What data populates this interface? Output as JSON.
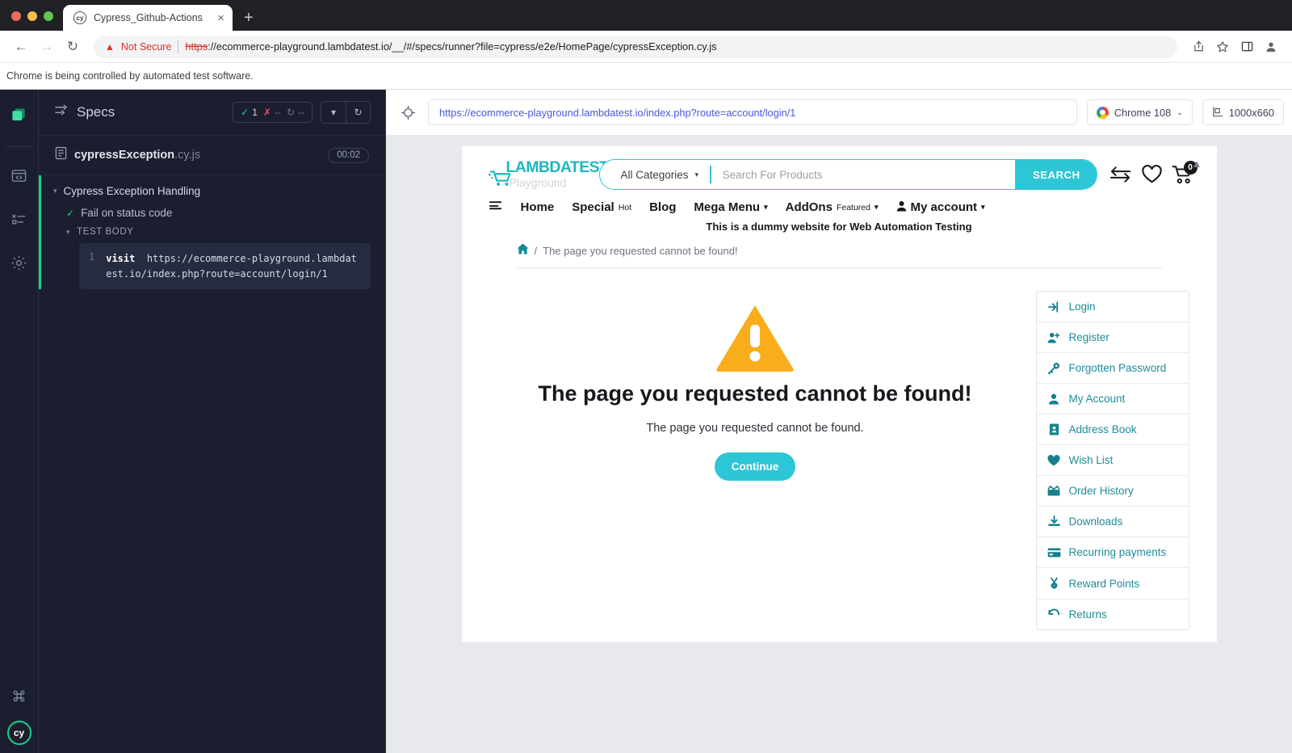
{
  "browser": {
    "tab": {
      "title": "Cypress_Github-Actions",
      "favicon": "cypress-favicon",
      "close": "×"
    },
    "new_tab_label": "+",
    "nav": {
      "back": "←",
      "forward": "→",
      "reload": "↻"
    },
    "omnibox": {
      "security_label": "Not Secure",
      "warning_icon": "warning-triangle-icon",
      "url_scheme": "https",
      "url_rest": "://ecommerce-playground.lambdatest.io/__/#/specs/runner?file=cypress/e2e/HomePage/cypressException.cy.js"
    },
    "toolbar_icons": [
      "share-icon",
      "bookmark-star-icon",
      "side-panel-icon",
      "profile-icon"
    ],
    "automation_notice": "Chrome is being controlled by automated test software."
  },
  "cypress": {
    "rail": [
      {
        "name": "specs-rail-icon"
      },
      {
        "name": "runs-rail-icon"
      },
      {
        "name": "debug-rail-icon"
      },
      {
        "name": "settings-gear-icon"
      }
    ],
    "rail_bottom": {
      "keyboard_shortcut_icon": "command-key-icon",
      "logo": "cy"
    },
    "specs_header": {
      "title": "Specs",
      "list_icon": "specs-list-icon",
      "stats": {
        "passed_icon": "check-icon",
        "passed": "1",
        "failed_icon": "x-icon",
        "failed": "--",
        "pending_icon": "pending-icon",
        "pending": "--"
      },
      "collapse_icon": "chevron-down-icon",
      "reload_icon": "refresh-icon"
    },
    "spec": {
      "file_icon": "file-icon",
      "name": "cypressException",
      "extension": ".cy.js",
      "duration": "00:02"
    },
    "tree": {
      "suite": "Cypress Exception Handling",
      "test": "Fail on status code",
      "section": "TEST BODY",
      "code": {
        "line_number": "1",
        "command": "visit",
        "argument": "https://ecommerce-playground.lambdatest.io/index.php?route=account/login/1"
      }
    },
    "aut_bar": {
      "selector_icon": "selector-playground-icon",
      "url": "https://ecommerce-playground.lambdatest.io/index.php?route=account/login/1",
      "browser_icon": "chrome-icon",
      "browser_label": "Chrome 108",
      "browser_caret": "⌄",
      "viewport_icon": "viewport-icon",
      "viewport_label": "1000x660"
    }
  },
  "site": {
    "scroll_up_icon": "chevron-up-icon",
    "logo": {
      "name": "LAMBDATEST",
      "subtitle": "Playground",
      "icon": "cart-logo-icon"
    },
    "search": {
      "category_label": "All Categories",
      "category_caret": "⌄",
      "placeholder": "Search For Products",
      "value": "",
      "button_label": "SEARCH"
    },
    "header_icons": [
      {
        "name": "compare-icon",
        "glyph": "compare"
      },
      {
        "name": "wishlist-heart-icon",
        "glyph": "heart"
      },
      {
        "name": "cart-icon",
        "glyph": "cart",
        "badge": "0"
      }
    ],
    "nav": [
      {
        "label": "Home",
        "icon": "menu-lines-icon",
        "badge": "",
        "caret": false
      },
      {
        "label": "Special",
        "badge": "Hot",
        "caret": false
      },
      {
        "label": "Blog",
        "badge": "",
        "caret": false
      },
      {
        "label": "Mega Menu",
        "badge": "",
        "caret": true
      },
      {
        "label": "AddOns",
        "badge": "Featured",
        "caret": true
      },
      {
        "label": "My account",
        "icon": "user-icon",
        "badge": "",
        "caret": true
      }
    ],
    "tagline": "This is a dummy website for Web Automation Testing",
    "breadcrumb": {
      "home_icon": "home-icon",
      "separator": "/",
      "current": "The page you requested cannot be found!"
    },
    "error": {
      "icon": "warning-triangle-icon",
      "title": "The page you requested cannot be found!",
      "text": "The page you requested cannot be found.",
      "button_label": "Continue"
    },
    "account_menu": [
      {
        "label": "Login",
        "icon": "login-arrow-icon"
      },
      {
        "label": "Register",
        "icon": "user-plus-icon"
      },
      {
        "label": "Forgotten Password",
        "icon": "key-icon"
      },
      {
        "label": "My Account",
        "icon": "user-icon"
      },
      {
        "label": "Address Book",
        "icon": "address-book-icon"
      },
      {
        "label": "Wish List",
        "icon": "heart-icon"
      },
      {
        "label": "Order History",
        "icon": "package-icon"
      },
      {
        "label": "Downloads",
        "icon": "download-icon"
      },
      {
        "label": "Recurring payments",
        "icon": "credit-card-icon"
      },
      {
        "label": "Reward Points",
        "icon": "medal-icon"
      },
      {
        "label": "Returns",
        "icon": "undo-arrow-icon"
      }
    ]
  },
  "colors": {
    "teal": "#2DC6D6",
    "teal_dark": "#17808D",
    "warning_orange": "#F9AD1B",
    "cypress_green": "#1CD08C",
    "not_secure_red": "#d93025"
  }
}
